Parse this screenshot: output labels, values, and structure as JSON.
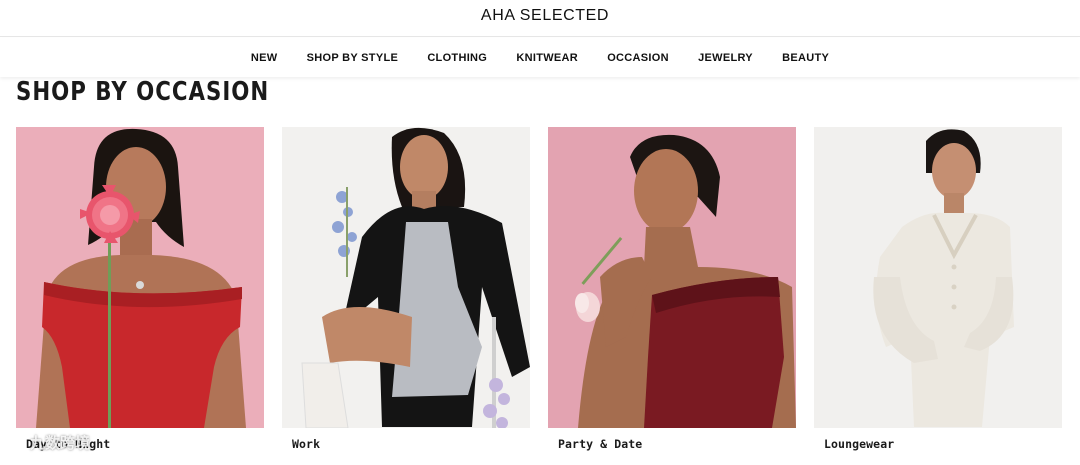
{
  "header": {
    "logo": "AHA SELECTED"
  },
  "nav": {
    "items": [
      {
        "label": "NEW"
      },
      {
        "label": "SHOP BY STYLE"
      },
      {
        "label": "CLOTHING"
      },
      {
        "label": "KNITWEAR"
      },
      {
        "label": "OCCASION"
      },
      {
        "label": "JEWELRY"
      },
      {
        "label": "BEAUTY"
      }
    ]
  },
  "section": {
    "title": "SHOP BY OCCASION"
  },
  "cards": [
    {
      "label": "Day to Night"
    },
    {
      "label": "Work"
    },
    {
      "label": "Party & Date"
    },
    {
      "label": "Loungewear"
    }
  ],
  "watermark": {
    "text": "九数跨境"
  },
  "colors": {
    "pink_bg": "#e8a7b4",
    "white_bg": "#f2f1ef",
    "red_top": "#c8282c",
    "velvet": "#7a1a22",
    "grey_dress": "#b9bcc2",
    "black_blazer": "#141414",
    "cream_knit": "#ece8e0"
  }
}
